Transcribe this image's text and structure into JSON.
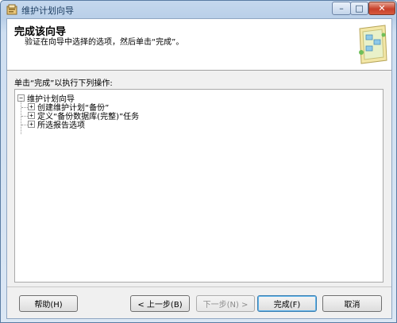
{
  "window": {
    "title": "维护计划向导",
    "controls": {
      "minimize_glyph": "–",
      "maximize_glyph": "□",
      "close_glyph": "✕"
    }
  },
  "header": {
    "title": "完成该向导",
    "subtitle": "验证在向导中选择的选项，然后单击“完成”。"
  },
  "actions_label": "单击“完成”以执行下列操作:",
  "tree": {
    "root": {
      "label": "维护计划向导",
      "expander": "−"
    },
    "children": [
      {
        "label": "创建维护计划“备份”",
        "expander": "+"
      },
      {
        "label": "定义“备份数据库(完整)”任务",
        "expander": "+"
      },
      {
        "label": "所选报告选项",
        "expander": "+"
      }
    ]
  },
  "buttons": {
    "help": "帮助(H)",
    "back": "< 上一步(B)",
    "next": "下一步(N) >",
    "finish": "完成(F)",
    "cancel": "取消"
  },
  "colors": {
    "accent": "#3c7fb1",
    "close": "#c7402a"
  }
}
